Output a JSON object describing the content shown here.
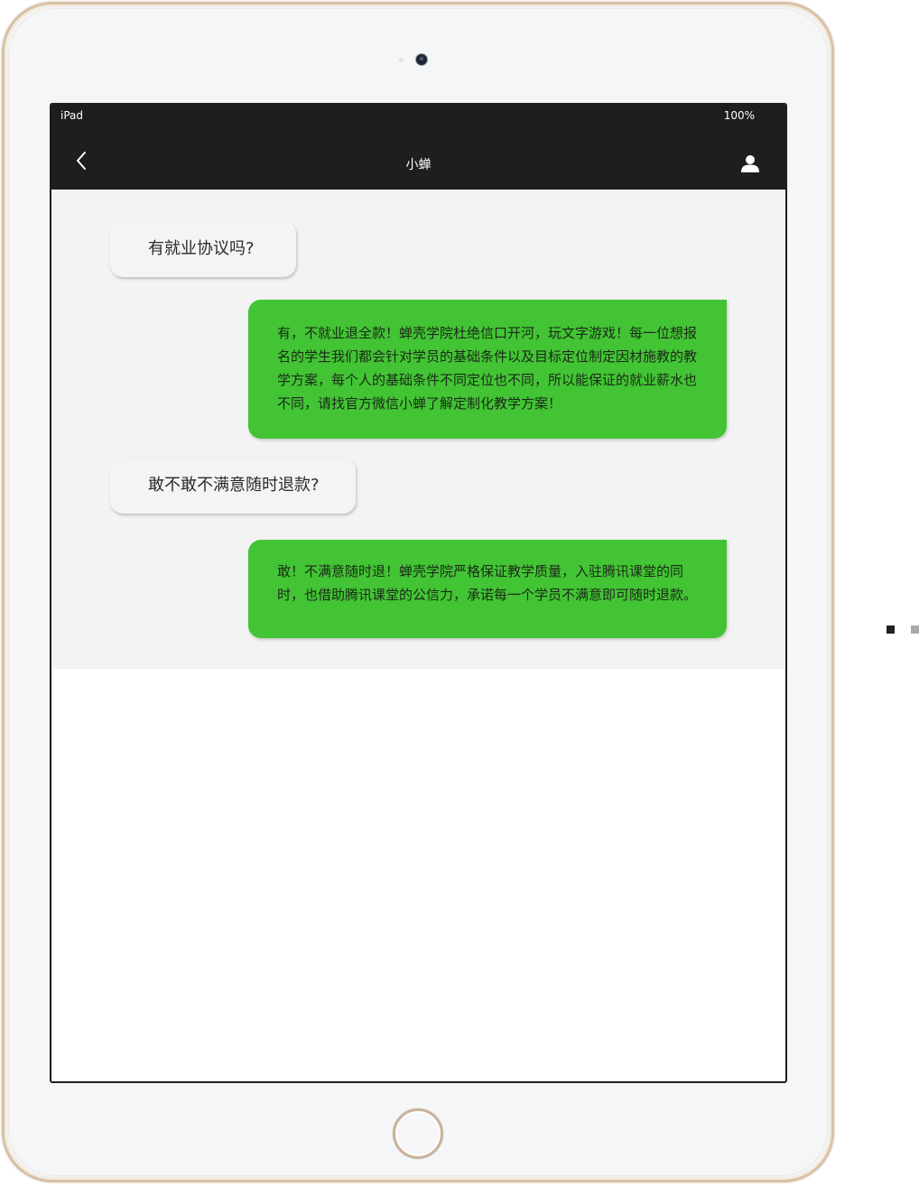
{
  "device": {
    "status_name": "iPad",
    "battery": "100%"
  },
  "nav": {
    "title": "小蝉",
    "back_icon": "chevron-left-icon",
    "profile_icon": "user-icon"
  },
  "messages": [
    {
      "side": "incoming",
      "text": "有就业协议吗?"
    },
    {
      "side": "outgoing",
      "text": "有，不就业退全款！蝉壳学院杜绝信口开河，玩文字游戏！每一位想报名的学生我们都会针对学员的基础条件以及目标定位制定因材施教的教学方案，每个人的基础条件不同定位也不同，所以能保证的就业薪水也不同，请找官方微信小蝉了解定制化教学方案！"
    },
    {
      "side": "incoming",
      "text": "敢不敢不满意随时退款?"
    },
    {
      "side": "outgoing",
      "text": "敢！不满意随时退！蝉壳学院严格保证教学质量，入驻腾讯课堂的同时，也借助腾讯课堂的公信力，承诺每一个学员不满意即可随时退款。"
    }
  ],
  "colors": {
    "header_bg": "#1e1e1e",
    "chat_bg": "#f3f3f3",
    "incoming_bubble": "#f4f4f4",
    "outgoing_bubble": "#42c434",
    "pager_active": "#222222",
    "pager_inactive": "#aaaaaa"
  },
  "pager": {
    "count": 2,
    "active_index": 0
  }
}
